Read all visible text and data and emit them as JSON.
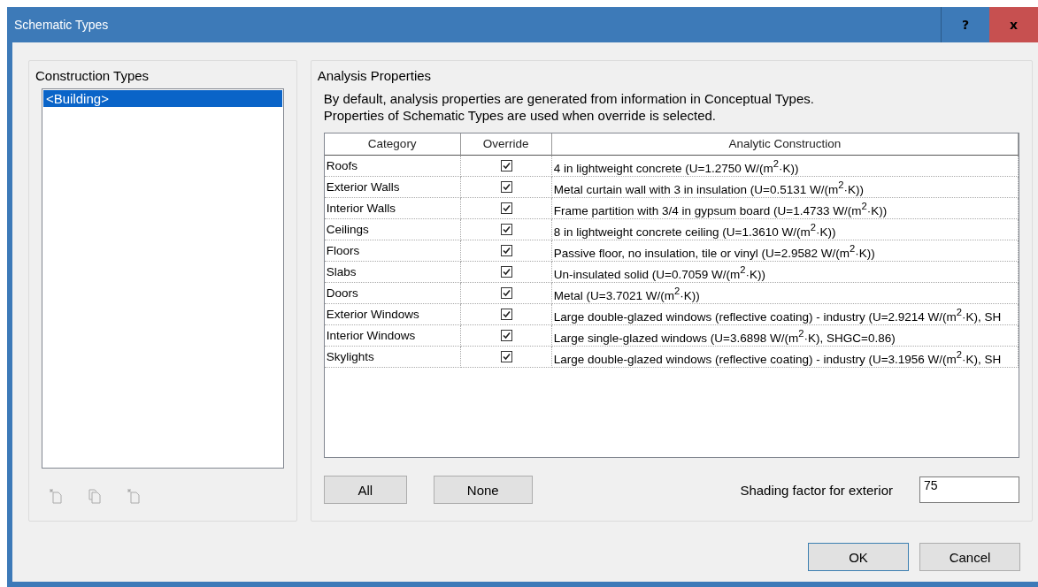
{
  "window": {
    "title": "Schematic Types",
    "buttons": [
      "?",
      "x"
    ]
  },
  "construction_types": {
    "title": "Construction Types",
    "items": [
      {
        "label": "<Building>",
        "selected": true
      }
    ]
  },
  "analysis_properties": {
    "title": "Analysis Properties",
    "description": [
      "By default, analysis properties are generated from information in Conceptual Types.",
      "Properties of Schematic Types are used when override is selected."
    ],
    "table": {
      "columns": [
        "Category",
        "Override",
        "Analytic Construction"
      ],
      "rows": [
        {
          "category": "Roofs",
          "override": true,
          "construction": "4 in lightweight concrete (U=1.2750 W/(m$^{2}$·K))"
        },
        {
          "category": "Exterior Walls",
          "override": true,
          "construction": "Metal curtain wall with 3 in insulation (U=0.5131 W/(m$^{2}$·K))"
        },
        {
          "category": "Interior Walls",
          "override": true,
          "construction": "Frame partition with 3/4 in gypsum board (U=1.4733 W/(m$^{2}$·K))"
        },
        {
          "category": "Ceilings",
          "override": true,
          "construction": "8 in lightweight concrete ceiling (U=1.3610 W/(m$^{2}$·K))"
        },
        {
          "category": "Floors",
          "override": true,
          "construction": "Passive floor, no insulation, tile or vinyl (U=2.9582 W/(m$^{2}$·K))"
        },
        {
          "category": "Slabs",
          "override": true,
          "construction": "Un-insulated solid (U=0.7059 W/(m$^{2}$·K))"
        },
        {
          "category": "Doors",
          "override": true,
          "construction": "Metal (U=3.7021 W/(m$^{2}$·K))"
        },
        {
          "category": "Exterior Windows",
          "override": true,
          "construction": "Large double-glazed windows (reflective coating) - industry (U=2.9214 W/(m$^{2}$·K), SH"
        },
        {
          "category": "Interior Windows",
          "override": true,
          "construction": "Large single-glazed windows (U=3.6898 W/(m$^{2}$·K), SHGC=0.86)"
        },
        {
          "category": "Skylights",
          "override": true,
          "construction": "Large double-glazed windows (reflective coating) - industry (U=3.1956 W/(m$^{2}$·K), SH"
        }
      ]
    },
    "buttons": [
      "All",
      "None"
    ],
    "shading": {
      "label": "Shading factor for exterior",
      "value": "75"
    }
  },
  "footer_buttons": [
    {
      "label": "OK",
      "default": true
    },
    {
      "label": "Cancel",
      "default": false
    }
  ]
}
